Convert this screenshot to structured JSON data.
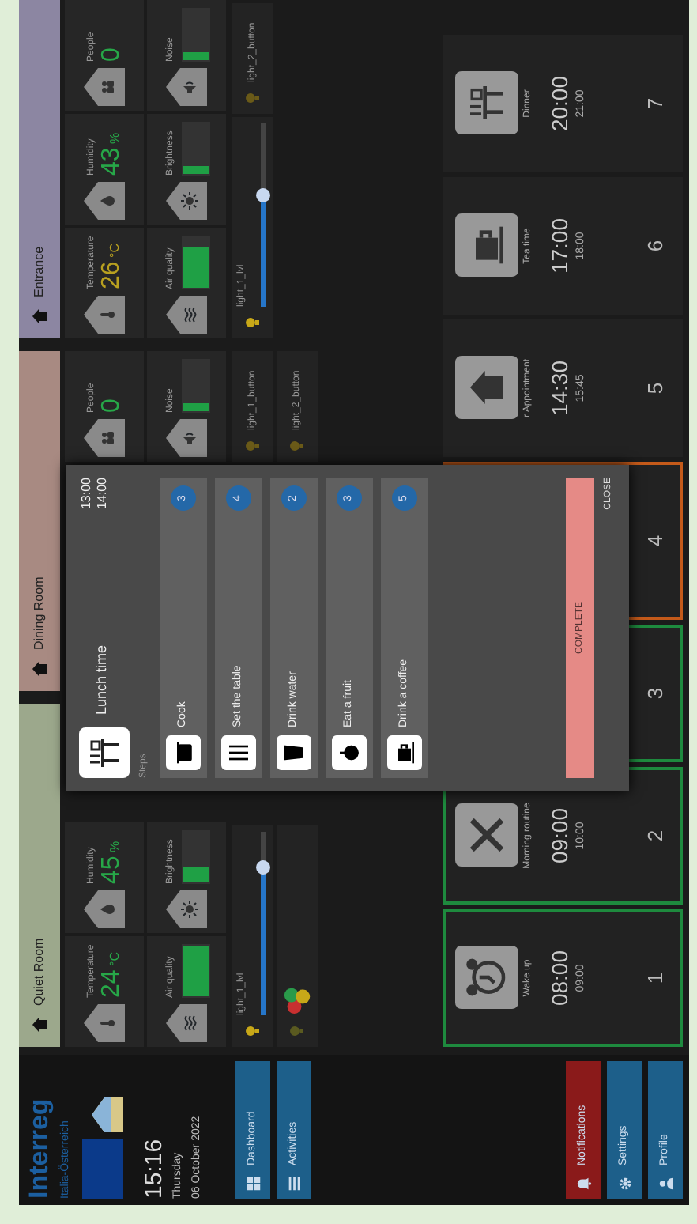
{
  "sidebar": {
    "logo_title": "Interreg",
    "logo_subtitle": "Italia-Österreich",
    "time": "15:16",
    "day": "Thursday",
    "date": "06 October 2022",
    "nav": [
      {
        "label": "Dashboard",
        "kind": "dashboard"
      },
      {
        "label": "Activities",
        "kind": "activities"
      }
    ],
    "bottom": [
      {
        "label": "Notifications",
        "kind": "notifications"
      },
      {
        "label": "Settings",
        "kind": "settings"
      },
      {
        "label": "Profile",
        "kind": "profile"
      }
    ]
  },
  "rooms": [
    {
      "name": "Quiet Room",
      "color": "#9ca88c",
      "tiles": [
        {
          "kind": "temperature",
          "label": "Temperature",
          "value": "24",
          "unit": "°C",
          "color": "#27a748"
        },
        {
          "kind": "air_quality",
          "label": "Air quality",
          "level": 1.0
        },
        {
          "kind": "humidity",
          "label": "Humidity",
          "value": "45",
          "unit": "%",
          "color": "#27a748"
        },
        {
          "kind": "brightness",
          "label": "Brightness",
          "level": 0.3
        }
      ],
      "lights": [
        {
          "kind": "slider",
          "label": "light_1_lvl",
          "level": 0.8
        },
        {
          "kind": "color"
        }
      ]
    },
    {
      "name": "Dining Room",
      "color": "#a88a82",
      "tiles": [
        {
          "kind": "people",
          "label": "People",
          "value": "0",
          "color": "#27a748"
        },
        {
          "kind": "noise",
          "label": "Noise",
          "level": 0.15
        }
      ],
      "lights": [
        {
          "kind": "button",
          "label": "light_1_button"
        },
        {
          "kind": "button",
          "label": "light_2_button"
        }
      ]
    },
    {
      "name": "Entrance",
      "color": "#8c86a2",
      "tiles": [
        {
          "kind": "temperature",
          "label": "Temperature",
          "value": "26",
          "unit": "°C",
          "color": "#b8a020"
        },
        {
          "kind": "air_quality",
          "label": "Air quality",
          "level": 0.8
        },
        {
          "kind": "humidity",
          "label": "Humidity",
          "value": "43",
          "unit": "%",
          "color": "#27a748"
        },
        {
          "kind": "brightness",
          "label": "Brightness",
          "level": 0.15
        },
        {
          "kind": "people",
          "label": "People",
          "value": "0",
          "color": "#27a748"
        },
        {
          "kind": "noise",
          "label": "Noise",
          "level": 0.15
        }
      ],
      "lights": [
        {
          "kind": "slider",
          "label": "light_1_lvl",
          "level": 0.6
        },
        {
          "kind": "button",
          "label": "light_2_button"
        }
      ]
    }
  ],
  "activities": [
    {
      "name": "Wake up",
      "start": "08:00",
      "end": "09:00",
      "number": "1",
      "done": true,
      "current": false
    },
    {
      "name": "Morning routine",
      "start": "09:00",
      "end": "10:00",
      "number": "2",
      "done": true,
      "current": false
    },
    {
      "number": "3",
      "done": true,
      "current": false
    },
    {
      "number": "4",
      "done": false,
      "current": true
    },
    {
      "name": "r Appointment",
      "start": "14:30",
      "end": "15:45",
      "number": "5",
      "done": false,
      "current": false
    },
    {
      "name": "Tea time",
      "start": "17:00",
      "end": "18:00",
      "number": "6",
      "done": false,
      "current": false
    },
    {
      "name": "Dinner",
      "start": "20:00",
      "end": "21:00",
      "number": "7",
      "done": false,
      "current": false
    }
  ],
  "dialog": {
    "title": "Lunch time",
    "start": "13:00",
    "end": "14:00",
    "steps_label": "Steps",
    "steps": [
      {
        "label": "Cook",
        "count": "3"
      },
      {
        "label": "Set the table",
        "count": "4"
      },
      {
        "label": "Drink water",
        "count": "2"
      },
      {
        "label": "Eat a fruit",
        "count": "3"
      },
      {
        "label": "Drink a coffee",
        "count": "5"
      }
    ],
    "complete": "COMPLETE",
    "close": "CLOSE"
  }
}
